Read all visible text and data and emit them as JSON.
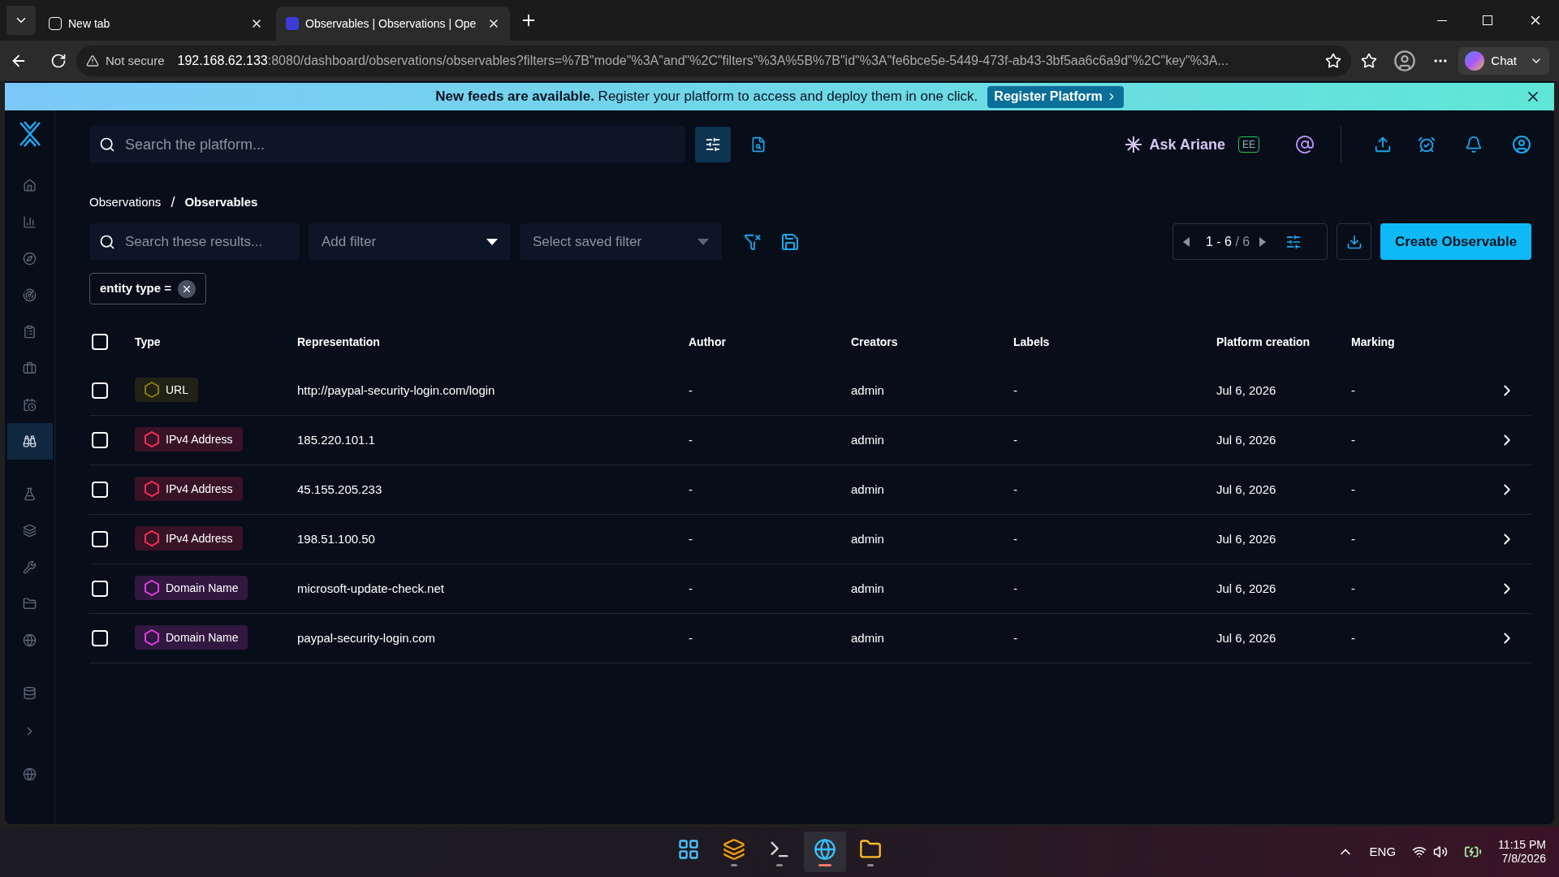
{
  "browser": {
    "tabs": [
      {
        "title": "New tab",
        "selected": false
      },
      {
        "title": "Observables | Observations | Ope",
        "selected": true
      }
    ],
    "security": "Not secure",
    "url_host": "192.168.62.133",
    "url_path": ":8080/dashboard/observations/observables?filters=%7B\"mode\"%3A\"and\"%2C\"filters\"%3A%5B%7B\"id\"%3A\"fe6bce5e-5449-473f-ab43-3bf5aa6c6a9d\"%2C\"key\"%3A...",
    "chat": "Chat"
  },
  "banner": {
    "message": "**New feeds are available.** Register your platform to access and deploy them in one click.",
    "button": "Register Platform"
  },
  "sidebar": {
    "items": [
      {
        "selected": false
      },
      {
        "selected": false
      },
      {
        "selected": false
      },
      {
        "selected": false
      },
      {
        "selected": false
      },
      {
        "selected": false
      },
      {
        "selected": false
      },
      {
        "selected": true
      },
      {
        "selected": false
      },
      {
        "selected": false
      },
      {
        "selected": false
      },
      {
        "selected": false
      },
      {
        "selected": false
      },
      {
        "selected": false
      }
    ]
  },
  "header": {
    "search_placeholder": "Search the platform...",
    "ask": "Ask Ariane",
    "badge": "EE"
  },
  "breadcrumb": {
    "items": [
      "Observations",
      "Observables"
    ],
    "separator": "/"
  },
  "toolbar": {
    "search_placeholder": "Search these results...",
    "add_filter": "Add filter",
    "saved_filter": "Select saved filter",
    "pagination": "1 - 6",
    "total": "/ 6",
    "create": "Create Observable"
  },
  "filter_chips": [
    {
      "label": "entity type ="
    }
  ],
  "table": {
    "select_all": {
      "checked": false
    },
    "columns": [
      "Type",
      "Representation",
      "Author",
      "Creators",
      "Labels",
      "Platform creation",
      "Marking"
    ],
    "rows": [
      {
        "checked": false,
        "type": "URL",
        "color": "#8a7a0c",
        "representation": "http://paypal-security-login.com/login",
        "author": "-",
        "creators": "admin",
        "labels": "-",
        "created": "Jul 6, 2026",
        "marking": "-"
      },
      {
        "checked": false,
        "type": "IPv4 Address",
        "color": "#ff2d55",
        "representation": "185.220.101.1",
        "author": "-",
        "creators": "admin",
        "labels": "-",
        "created": "Jul 6, 2026",
        "marking": "-"
      },
      {
        "checked": false,
        "type": "IPv4 Address",
        "color": "#ff2d55",
        "representation": "45.155.205.233",
        "author": "-",
        "creators": "admin",
        "labels": "-",
        "created": "Jul 6, 2026",
        "marking": "-"
      },
      {
        "checked": false,
        "type": "IPv4 Address",
        "color": "#ff2d55",
        "representation": "198.51.100.50",
        "author": "-",
        "creators": "admin",
        "labels": "-",
        "created": "Jul 6, 2026",
        "marking": "-"
      },
      {
        "checked": false,
        "type": "Domain Name",
        "color": "#e040e0",
        "representation": "microsoft-update-check.net",
        "author": "-",
        "creators": "admin",
        "labels": "-",
        "created": "Jul 6, 2026",
        "marking": "-"
      },
      {
        "checked": false,
        "type": "Domain Name",
        "color": "#e040e0",
        "representation": "paypal-security-login.com",
        "author": "-",
        "creators": "admin",
        "labels": "-",
        "created": "Jul 6, 2026",
        "marking": "-"
      }
    ]
  },
  "taskbar": {
    "apps": [
      {
        "selected": false
      },
      {
        "selected": false
      },
      {
        "selected": false
      },
      {
        "selected": true
      },
      {
        "selected": false
      }
    ],
    "language": "ENG",
    "time": "11:15 PM",
    "date": "7/8/2026"
  }
}
